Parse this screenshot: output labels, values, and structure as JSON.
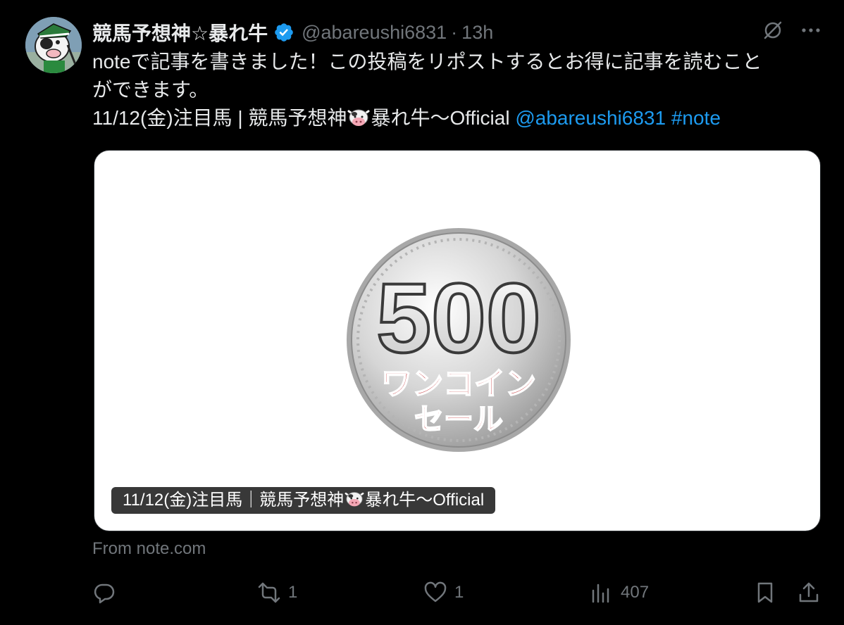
{
  "post": {
    "author": {
      "display_name": "競馬予想神☆暴れ牛",
      "handle": "@abareushi6831",
      "verified": true
    },
    "separator": "·",
    "time": "13h",
    "body": {
      "line1": "noteで記事を書きました！この投稿をリポストするとお得に記事を読むこと",
      "line2": "ができます。",
      "line3_prefix": "11/12(金)注目馬 | 競馬予想神",
      "line3_suffix": "暴れ牛〜Official",
      "mention": "@abareushi6831",
      "hashtag": "#note"
    },
    "card": {
      "coin_value": "500",
      "coin_text_1": "ワンコイン",
      "coin_text_2": "セール",
      "caption_prefix": "11/12(金)注目馬｜競馬予想神",
      "caption_suffix": "暴れ牛〜Official"
    },
    "source": "From note.com",
    "actions": {
      "reply_count": "",
      "repost_count": "1",
      "like_count": "1",
      "views_count": "407"
    }
  },
  "icons": {
    "verified": "verified-badge-icon",
    "grok": "grok-icon",
    "more": "more-icon",
    "reply": "reply-icon",
    "repost": "repost-icon",
    "like": "heart-icon",
    "views": "views-icon",
    "bookmark": "bookmark-icon",
    "share": "share-icon",
    "cow": "cow-emoji-icon"
  },
  "colors": {
    "background": "#000000",
    "text": "#e7e9ea",
    "muted": "#71767b",
    "link": "#1d9bf0",
    "verified": "#1d9bf0",
    "coin_red": "#c0282d"
  }
}
